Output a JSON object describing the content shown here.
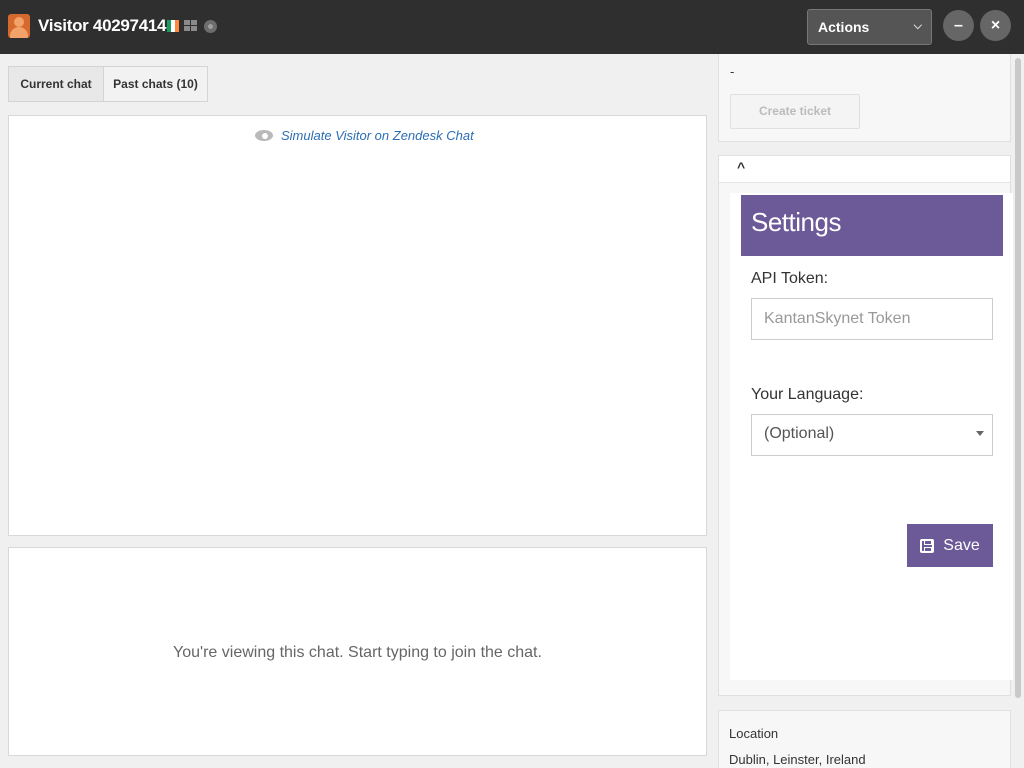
{
  "header": {
    "visitor_name": "Visitor 40297414",
    "country_flag": "ireland-flag-icon",
    "os_icon": "windows-icon",
    "browser_icon": "chrome-icon",
    "actions_label": "Actions",
    "minimize_label": "–",
    "close_label": "×"
  },
  "tabs": [
    {
      "label": "Current chat",
      "active": true
    },
    {
      "label": "Past chats (10)",
      "active": false
    }
  ],
  "chat": {
    "simulate_link": "Simulate Visitor on Zendesk Chat",
    "join_message": "You're viewing this chat. Start typing to join the chat."
  },
  "sidebar": {
    "dash": "-",
    "create_ticket_label": "Create ticket",
    "collapse_label": "^",
    "settings": {
      "title": "Settings",
      "api_label": "API Token:",
      "api_placeholder": "KantanSkynet Token",
      "language_label": "Your Language:",
      "language_value": "(Optional)",
      "save_label": "Save"
    },
    "location": {
      "title": "Location",
      "value": "Dublin, Leinster, Ireland"
    }
  },
  "colors": {
    "topbar": "#2f2f2f",
    "accent": "#6b5998",
    "link": "#2c6db4"
  }
}
